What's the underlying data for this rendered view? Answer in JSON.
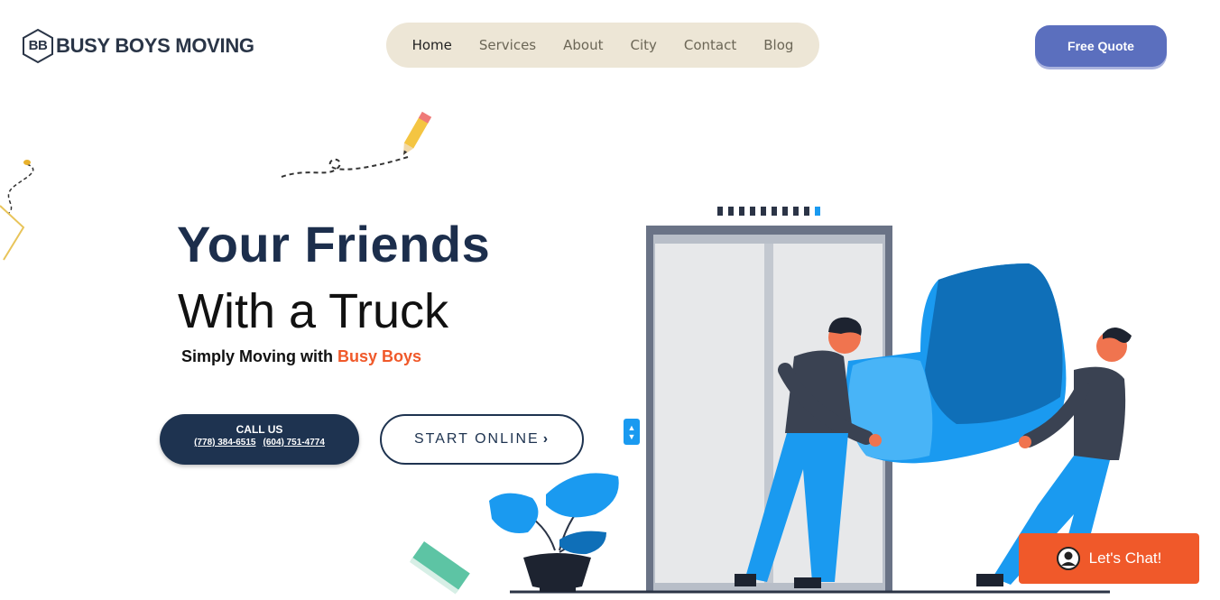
{
  "brand": {
    "monogram": "BB",
    "name": "BUSY BOYS MOVING"
  },
  "nav": {
    "items": [
      "Home",
      "Services",
      "About",
      "City",
      "Contact",
      "Blog"
    ],
    "active": "Home"
  },
  "header": {
    "quote_label": "Free Quote"
  },
  "hero": {
    "title_line1": "Your Friends",
    "title_line2": "With a Truck",
    "subtitle_prefix": "Simply Moving with ",
    "subtitle_accent": "Busy Boys",
    "call": {
      "label": "CALL US",
      "phone1": "(778) 384-6515",
      "phone2": "(604) 751-4774"
    },
    "start_label": "START ONLINE"
  },
  "chat": {
    "label": "Let's Chat!"
  },
  "colors": {
    "brand_dark": "#1e3350",
    "accent_orange": "#f0592a",
    "quote_blue": "#5b6fbe",
    "nav_bg": "#ede6d6",
    "couch_blue": "#1a9af0"
  }
}
